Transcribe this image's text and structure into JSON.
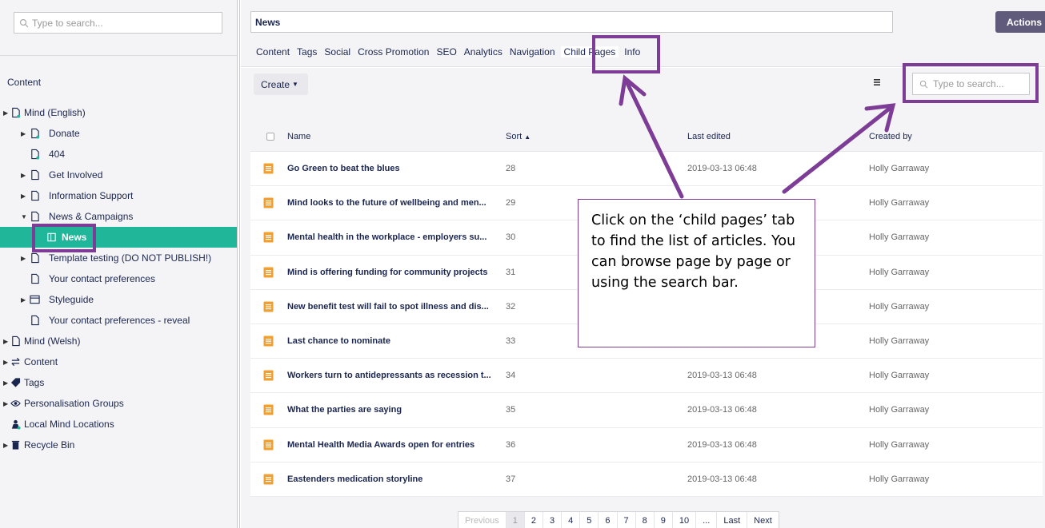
{
  "sidebar": {
    "search_placeholder": "Type to search...",
    "heading": "Content",
    "tree": [
      {
        "label": "Mind (English)",
        "depth": 0,
        "caret": true,
        "icon": "doc-green-icon"
      },
      {
        "label": "Donate",
        "depth": 1,
        "caret": true,
        "icon": "doc-green-icon"
      },
      {
        "label": "404",
        "depth": 1,
        "caret": false,
        "icon": "doc-green-icon"
      },
      {
        "label": "Get Involved",
        "depth": 1,
        "caret": true,
        "icon": "doc-icon"
      },
      {
        "label": "Information Support",
        "depth": 1,
        "caret": true,
        "icon": "doc-icon"
      },
      {
        "label": "News & Campaigns",
        "depth": 1,
        "caret": true,
        "caret_open": true,
        "icon": "doc-icon"
      },
      {
        "label": "News",
        "depth": 2,
        "caret": false,
        "icon": "book-icon",
        "selected": true
      },
      {
        "label": "Template testing (DO NOT PUBLISH!)",
        "depth": 1,
        "caret": true,
        "icon": "doc-icon"
      },
      {
        "label": "Your contact preferences",
        "depth": 1,
        "caret": false,
        "icon": "doc-icon"
      },
      {
        "label": "Styleguide",
        "depth": 1,
        "caret": true,
        "icon": "window-icon"
      },
      {
        "label": "Your contact preferences - reveal",
        "depth": 1,
        "caret": false,
        "icon": "doc-icon"
      },
      {
        "label": "Mind (Welsh)",
        "depth": 0,
        "caret": true,
        "icon": "doc-icon"
      },
      {
        "label": "Content",
        "depth": 0,
        "caret": true,
        "icon": "swap-icon"
      },
      {
        "label": "Tags",
        "depth": 0,
        "caret": true,
        "icon": "tag-icon"
      },
      {
        "label": "Personalisation Groups",
        "depth": 0,
        "caret": true,
        "icon": "eye-icon"
      },
      {
        "label": "Local Mind Locations",
        "depth": 0,
        "caret": false,
        "icon": "location-icon"
      },
      {
        "label": "Recycle Bin",
        "depth": 0,
        "caret": true,
        "icon": "trash-icon"
      }
    ]
  },
  "header": {
    "page_name": "News",
    "actions_label": "Actions",
    "tabs": [
      "Content",
      "Tags",
      "Social",
      "Cross Promotion",
      "SEO",
      "Analytics",
      "Navigation",
      "Child Pages",
      "Info"
    ],
    "active_tab": "Child Pages"
  },
  "toolbar": {
    "create_label": "Create",
    "search_placeholder": "Type to search..."
  },
  "table": {
    "columns": [
      "Name",
      "Sort",
      "Last edited",
      "Created by"
    ],
    "rows": [
      {
        "name": "Go Green to beat the blues",
        "sort": "28",
        "edited": "2019-03-13 06:48",
        "creator": "Holly Garraway"
      },
      {
        "name": "Mind looks to the future of wellbeing and men...",
        "sort": "29",
        "edited": "",
        "creator": "Holly Garraway"
      },
      {
        "name": "Mental health in the workplace - employers su...",
        "sort": "30",
        "edited": "",
        "creator": "Holly Garraway"
      },
      {
        "name": "Mind is offering funding for community projects",
        "sort": "31",
        "edited": "",
        "creator": "Holly Garraway"
      },
      {
        "name": "New benefit test will fail to spot illness and dis...",
        "sort": "32",
        "edited": "",
        "creator": "Holly Garraway"
      },
      {
        "name": "Last chance to nominate",
        "sort": "33",
        "edited": "",
        "creator": "Holly Garraway"
      },
      {
        "name": "Workers turn to antidepressants as recession t...",
        "sort": "34",
        "edited": "2019-03-13 06:48",
        "creator": "Holly Garraway"
      },
      {
        "name": "What the parties are saying",
        "sort": "35",
        "edited": "2019-03-13 06:48",
        "creator": "Holly Garraway"
      },
      {
        "name": "Mental Health Media Awards open for entries",
        "sort": "36",
        "edited": "2019-03-13 06:48",
        "creator": "Holly Garraway"
      },
      {
        "name": "Eastenders medication storyline",
        "sort": "37",
        "edited": "2019-03-13 06:48",
        "creator": "Holly Garraway"
      }
    ]
  },
  "pagination": {
    "previous": "Previous",
    "pages": [
      "1",
      "2",
      "3",
      "4",
      "5",
      "6",
      "7",
      "8",
      "9",
      "10",
      "..."
    ],
    "current": "1",
    "last": "Last",
    "next": "Next"
  },
  "annotation": {
    "callout_text": "Click on the ‘child pages’ tab to find the list of articles. You can browse page by page or using the search bar.",
    "color": "#7d3d96"
  },
  "colors": {
    "accent_green": "#1fb69a",
    "actions_purple": "#605a7b",
    "doc_orange": "#f0a030",
    "text_navy": "#1b264f"
  }
}
